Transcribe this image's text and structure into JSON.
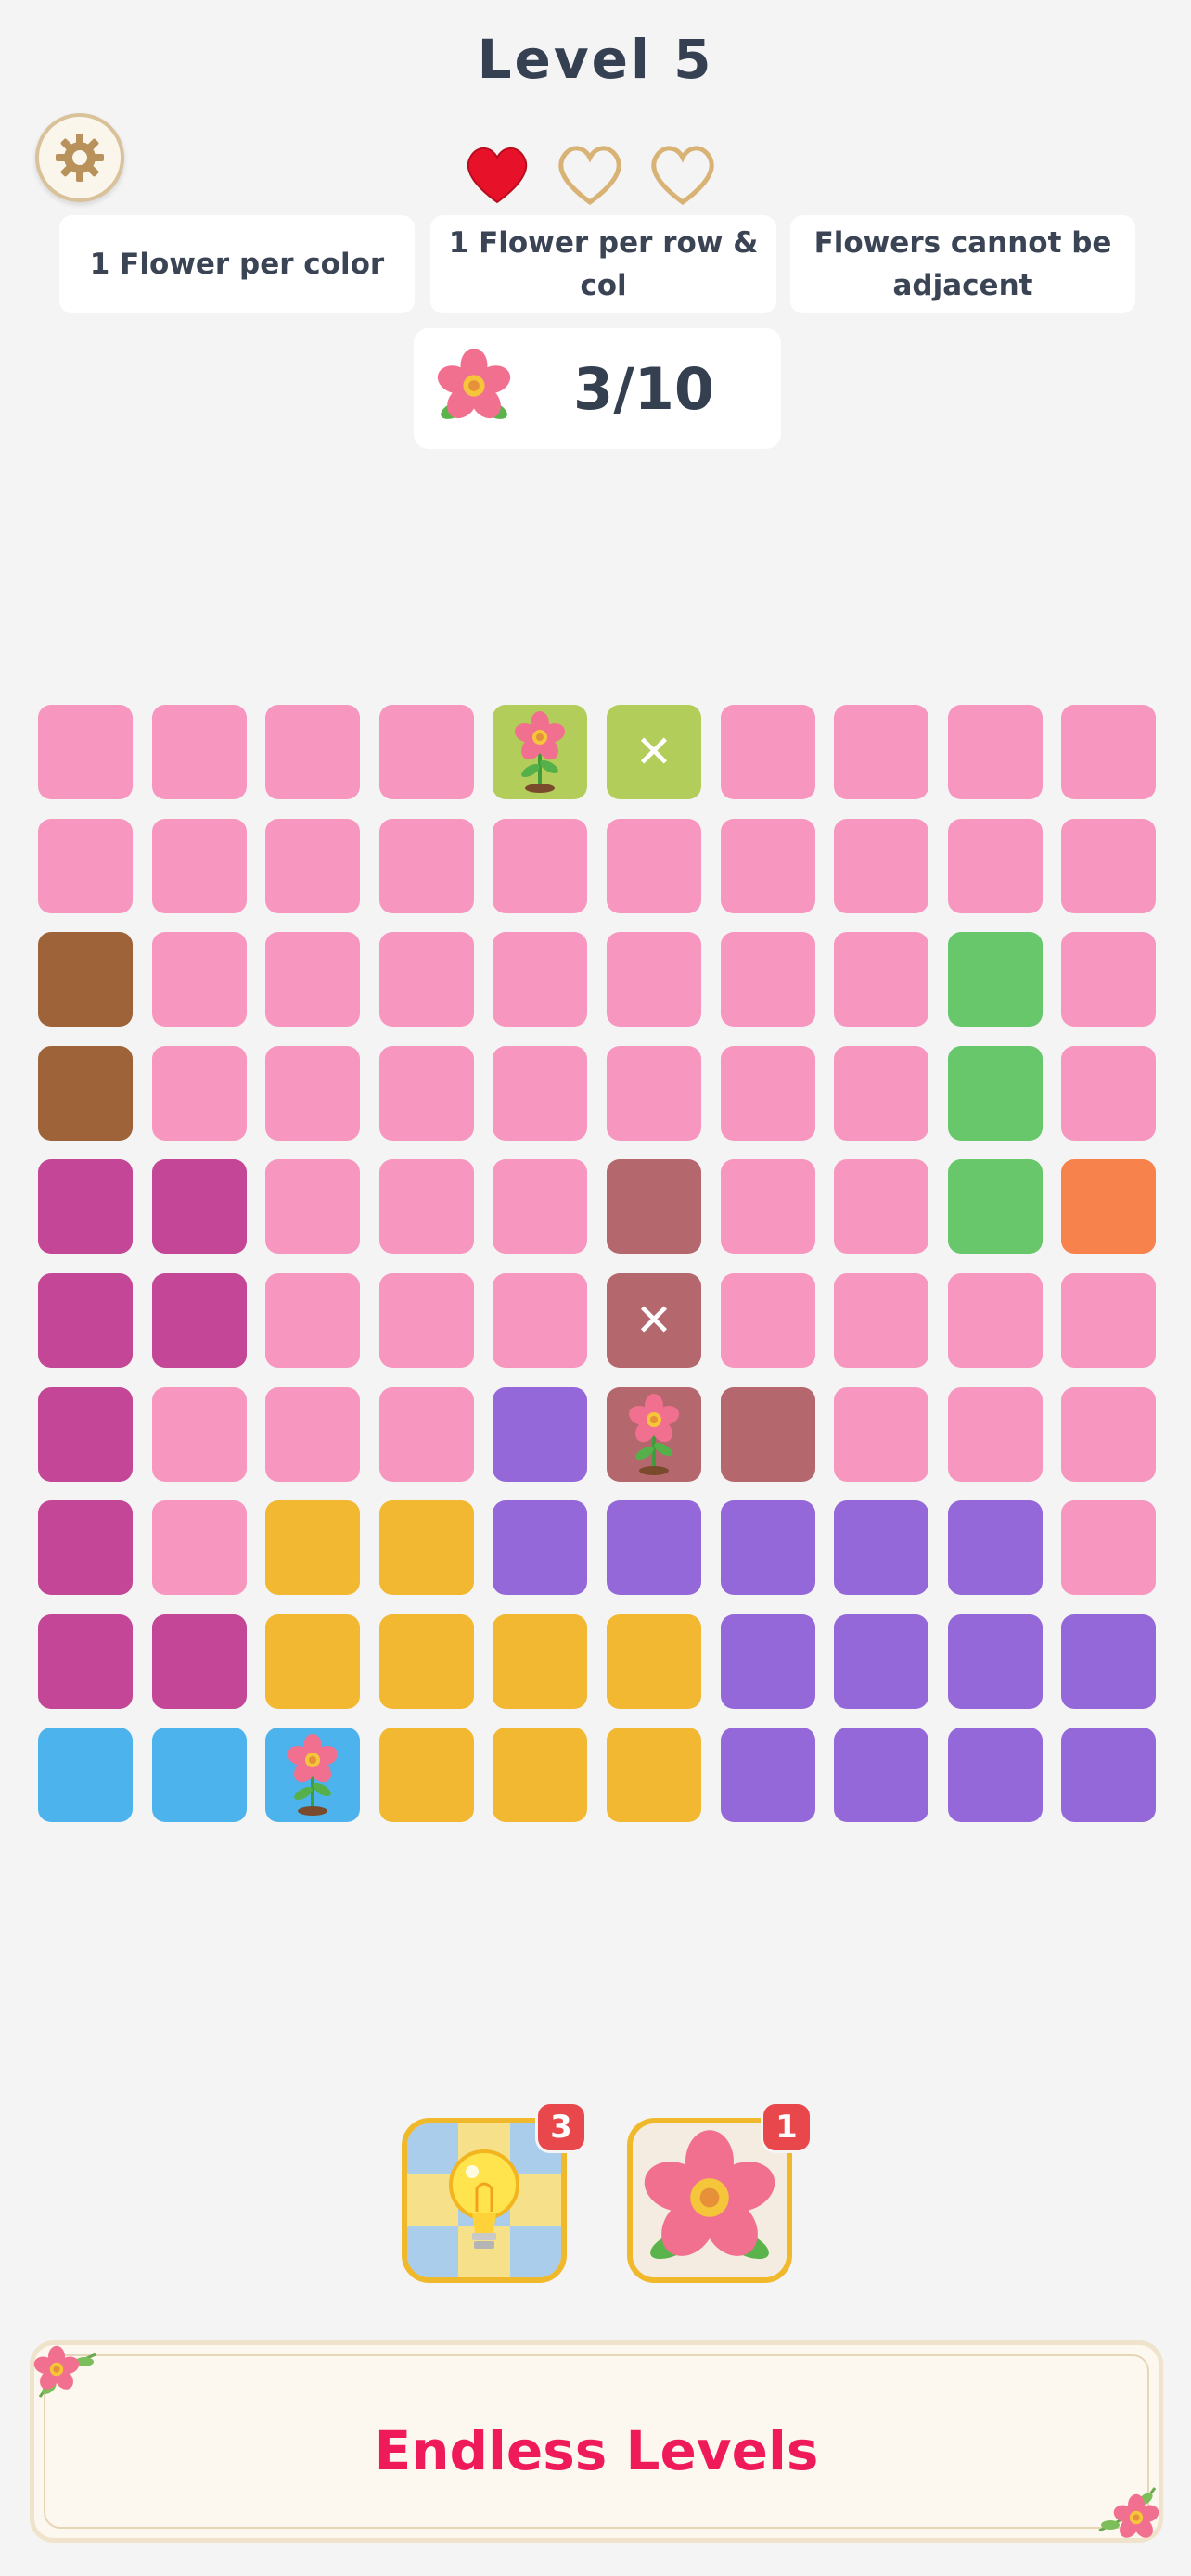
{
  "header": {
    "title": "Level 5"
  },
  "lives": {
    "total": 3,
    "filled": 1
  },
  "rules": [
    "1 Flower per color",
    "1 Flower per row & col",
    "Flowers cannot be adjacent"
  ],
  "counter": {
    "text": "3/10",
    "placed": 3,
    "target": 10
  },
  "board": {
    "colors": {
      "P": "#f797bf",
      "B": "#9e6338",
      "G": "#68c76a",
      "M": "#c44696",
      "R": "#b4676d",
      "O": "#f7824c",
      "V": "#9568da",
      "Y": "#f2b832",
      "C": "#4cb3ec",
      "L": "#b3cd5a"
    },
    "rows": [
      [
        "P",
        "P",
        "P",
        "P",
        "L",
        "L",
        "P",
        "P",
        "P",
        "P"
      ],
      [
        "P",
        "P",
        "P",
        "P",
        "P",
        "P",
        "P",
        "P",
        "P",
        "P"
      ],
      [
        "B",
        "P",
        "P",
        "P",
        "P",
        "P",
        "P",
        "P",
        "G",
        "P"
      ],
      [
        "B",
        "P",
        "P",
        "P",
        "P",
        "P",
        "P",
        "P",
        "G",
        "P"
      ],
      [
        "M",
        "M",
        "P",
        "P",
        "P",
        "R",
        "P",
        "P",
        "G",
        "O"
      ],
      [
        "M",
        "M",
        "P",
        "P",
        "P",
        "R",
        "P",
        "P",
        "P",
        "P"
      ],
      [
        "M",
        "P",
        "P",
        "P",
        "V",
        "R",
        "R",
        "P",
        "P",
        "P"
      ],
      [
        "M",
        "P",
        "Y",
        "Y",
        "V",
        "V",
        "V",
        "V",
        "V",
        "P"
      ],
      [
        "M",
        "M",
        "Y",
        "Y",
        "Y",
        "Y",
        "V",
        "V",
        "V",
        "V"
      ],
      [
        "C",
        "C",
        "C",
        "Y",
        "Y",
        "Y",
        "V",
        "V",
        "V",
        "V"
      ]
    ],
    "marks": [
      {
        "row": 0,
        "col": 4,
        "type": "flower"
      },
      {
        "row": 0,
        "col": 5,
        "type": "x"
      },
      {
        "row": 5,
        "col": 5,
        "type": "x"
      },
      {
        "row": 6,
        "col": 5,
        "type": "flower"
      },
      {
        "row": 9,
        "col": 2,
        "type": "flower"
      }
    ],
    "x_symbol": "✕"
  },
  "boosters": [
    {
      "name": "hint",
      "icon": "lightbulb-icon",
      "count": "3"
    },
    {
      "name": "flower",
      "icon": "flower-icon",
      "count": "1"
    }
  ],
  "banner": {
    "text": "Endless Levels"
  }
}
